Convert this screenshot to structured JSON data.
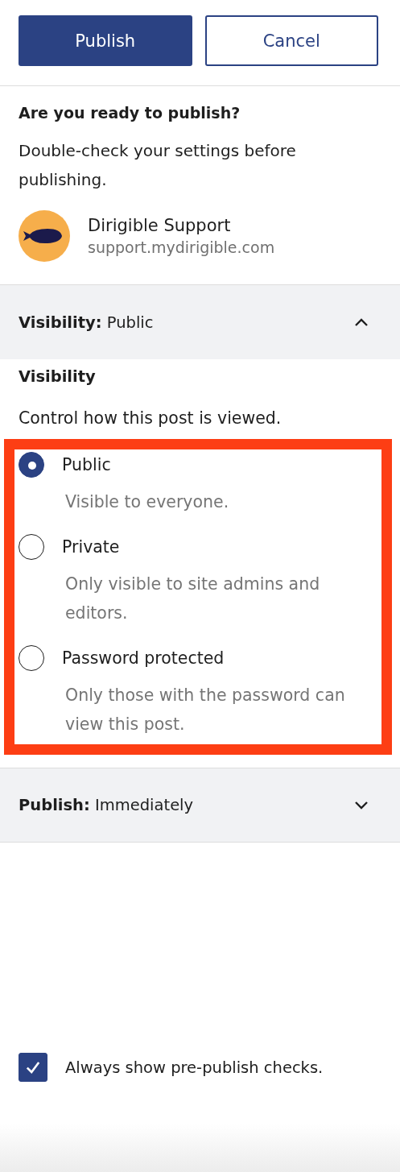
{
  "actions": [
    {
      "label": "Publish",
      "kind": "primary"
    },
    {
      "label": "Cancel",
      "kind": "secondary"
    }
  ],
  "intro": {
    "title": "Are you ready to publish?",
    "text": "Double-check your settings before publishing."
  },
  "site": {
    "name": "Dirigible Support",
    "url": "support.mydirigible.com"
  },
  "visibility_panel": {
    "heading": "**Visibility:** Public",
    "expanded": true,
    "title": "Visibility",
    "description": "Control how this post is viewed.",
    "options": [
      {
        "label": "Public",
        "help": "Visible to everyone.",
        "selected": true
      },
      {
        "label": "Private",
        "help": "Only visible to site admins and editors.",
        "selected": false
      },
      {
        "label": "Password protected",
        "help": "Only those with the password can view this post.",
        "selected": false
      }
    ]
  },
  "publish_panel": {
    "heading": "**Publish:** Immediately",
    "expanded": false
  },
  "prepublish_checkbox": {
    "label": "Always show pre-publish checks.",
    "checked": true
  }
}
